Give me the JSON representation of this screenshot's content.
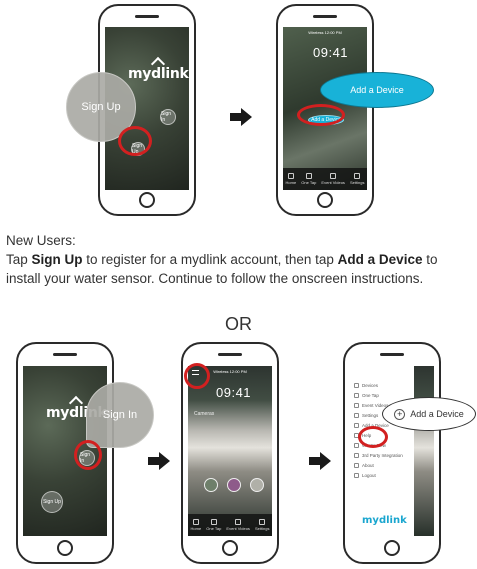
{
  "top_row": {
    "phone1": {
      "logo": "mydlink",
      "signup_bubble": "Sign Up",
      "signin_small": "Sign In",
      "signup_small": "Sign Up"
    },
    "phone2": {
      "status": "Wireless  12:00 PM",
      "time": "09:41",
      "add_device_pill": "Add a Device",
      "add_device_small": "Add a Device",
      "tabs": [
        "Home",
        "One Tap",
        "Event Videos",
        "Settings"
      ]
    }
  },
  "instructions": {
    "heading": "New Users:",
    "part1": "Tap ",
    "signup_bold": "Sign Up",
    "part2": " to register for a mydlink account, then tap ",
    "add_device_bold": "Add a Device",
    "part3": " to install your water sensor. Continue to follow the onscreen instructions."
  },
  "separator": "OR",
  "bottom_row": {
    "phone3": {
      "logo": "mydlink",
      "signin_bubble": "Sign In",
      "signin_small": "Sign In",
      "signup_small": "Sign Up"
    },
    "phone4": {
      "status": "Wireless  12:00 PM",
      "time": "09:41",
      "section": "Cameras",
      "tabs": [
        "Home",
        "One Tap",
        "Event Videos",
        "Settings"
      ]
    },
    "phone5": {
      "menu_items": [
        "Devices",
        "One Tap",
        "Event Videos",
        "Settings",
        "Add a Device",
        "Help",
        "What's New",
        "3rd Party Integration",
        "About",
        "Logout"
      ],
      "add_device_callout": "Add a Device",
      "logo": "mydlink"
    }
  },
  "colors": {
    "ring": "#d22020",
    "pill": "#18b2d8"
  }
}
